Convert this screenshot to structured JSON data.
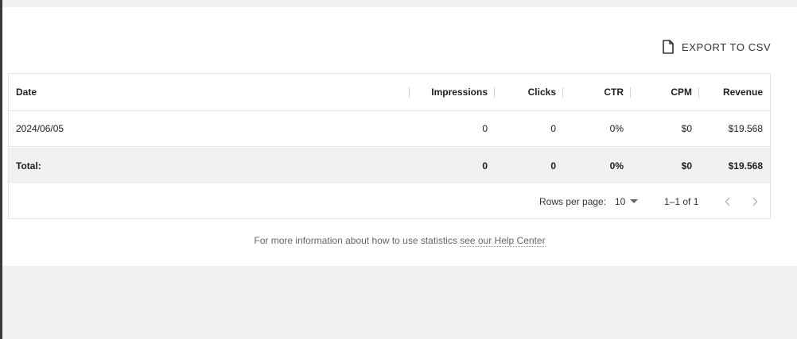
{
  "toolbar": {
    "export_label": "EXPORT TO CSV",
    "export_icon": "document-icon"
  },
  "table": {
    "columns": [
      "Date",
      "Impressions",
      "Clicks",
      "CTR",
      "CPM",
      "Revenue"
    ],
    "rows": [
      [
        "2024/06/05",
        "0",
        "0",
        "0%",
        "$0",
        "$19.568"
      ]
    ],
    "total": [
      "Total:",
      "0",
      "0",
      "0%",
      "$0",
      "$19.568"
    ]
  },
  "pagination": {
    "rows_per_page_label": "Rows per page:",
    "rows_per_page_value": "10",
    "range_label": "1–1 of 1"
  },
  "footer": {
    "text": "For more information about how to use statistics ",
    "link_text": "see our Help Center"
  },
  "colors": {
    "background": "#f1f1f1",
    "card": "#ffffff",
    "total_row": "#f1f1f1",
    "border": "#e3e3e3"
  }
}
